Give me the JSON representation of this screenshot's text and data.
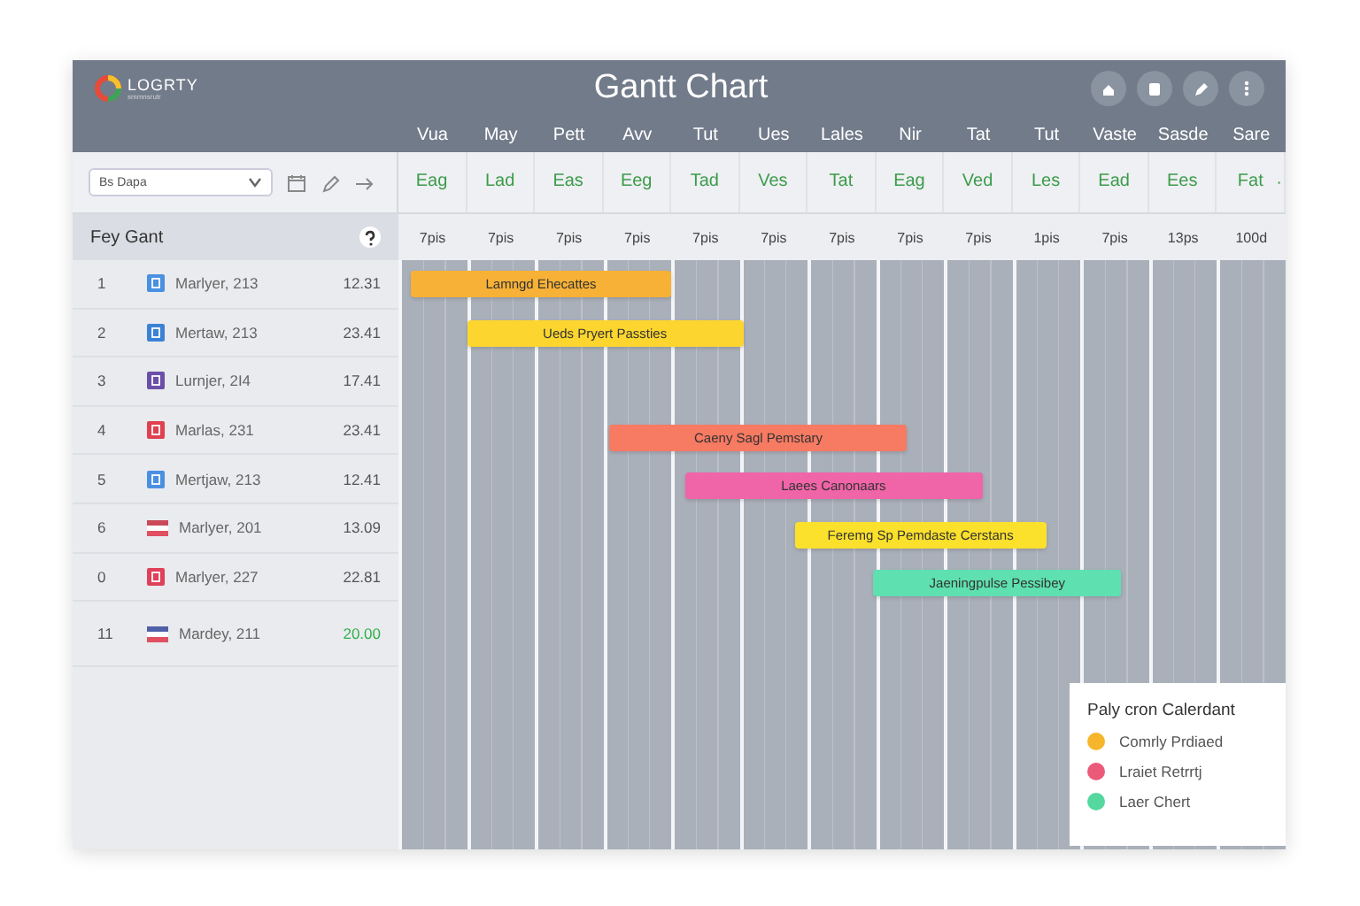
{
  "header": {
    "logo": {
      "name": "LOGRTY",
      "tagline": "smmnsrutr"
    },
    "title": "Gantt Chart"
  },
  "days": [
    "Vua",
    "May",
    "Pett",
    "Avv",
    "Tut",
    "Ues",
    "Lales",
    "Nir",
    "Tat",
    "Tut",
    "Vaste",
    "Sasde",
    "Sare"
  ],
  "toolbar": {
    "select": {
      "value": "Bs Dapa"
    },
    "more": "·"
  },
  "subdays": [
    "Eag",
    "Lad",
    "Eas",
    "Eeg",
    "Tad",
    "Ves",
    "Tat",
    "Eag",
    "Ved",
    "Les",
    "Ead",
    "Ees",
    "Fat"
  ],
  "panel_title": "Fey Gant",
  "times": [
    "7pis",
    "7pis",
    "7pis",
    "7pis",
    "7pis",
    "7pis",
    "7pis",
    "7pis",
    "7pis",
    "1pis",
    "7pis",
    "13ps",
    "100d"
  ],
  "rows": [
    {
      "number": "1",
      "kind": "square",
      "color": "#4a90e2",
      "name": "Marlyer, 213",
      "value": "12.31",
      "highlighted": false
    },
    {
      "number": "2",
      "kind": "square",
      "color": "#3b82d6",
      "name": "Mertaw, 213",
      "value": "23.41",
      "highlighted": false
    },
    {
      "number": "3",
      "kind": "square",
      "color": "#6b4fa8",
      "name": "Lurnjer, 2I4",
      "value": "17.41",
      "highlighted": false
    },
    {
      "number": "4",
      "kind": "square",
      "color": "#e0404f",
      "name": "Marlas, 231",
      "value": "23.41",
      "highlighted": false
    },
    {
      "number": "5",
      "kind": "square",
      "color": "#4a90e2",
      "name": "Mertjaw, 213",
      "value": "12.41",
      "highlighted": false
    },
    {
      "number": "6",
      "kind": "flag",
      "color": "#c94a5a",
      "name": "Marlyer, 201",
      "value": "13.09",
      "highlighted": false
    },
    {
      "number": "0",
      "kind": "square",
      "color": "#e0405a",
      "name": "Marlyer, 227",
      "value": "22.81",
      "highlighted": false
    },
    {
      "number": "11",
      "kind": "flag",
      "color": "#5060a8",
      "name": "Mardey, 211",
      "value": "20.00",
      "highlighted": true
    }
  ],
  "bars": [
    {
      "label": "Lamngd Ehecattes",
      "color": "#f7b136"
    },
    {
      "label": "Ueds Pryert Passties",
      "color": "#fcd62e"
    },
    {
      "label": "Caeny Sagl Pemstary",
      "color": "#f77a62"
    },
    {
      "label": "Laees Canonaars",
      "color": "#f064a8"
    },
    {
      "label": "Feremg Sp Pemdaste Cerstans",
      "color": "#fbe02c"
    },
    {
      "label": "Jaeningpulse Pessibey",
      "color": "#5ee0b0"
    }
  ],
  "legend": {
    "title": "Paly cron Calerdant",
    "items": [
      {
        "label": "Comrly Prdiaed",
        "color": "#f7b52c"
      },
      {
        "label": "Lraiet Retrrtj",
        "color": "#ec5a7a"
      },
      {
        "label": "Laer Chert",
        "color": "#55d8a0"
      }
    ]
  }
}
